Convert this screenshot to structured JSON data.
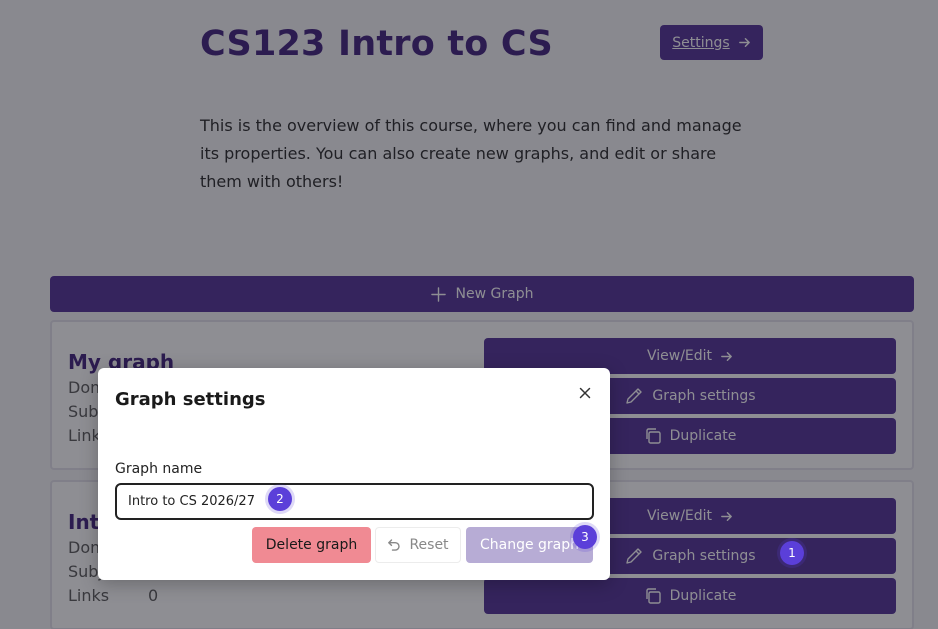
{
  "course": {
    "title": "CS123 Intro to CS",
    "settings_label": "Settings",
    "overview": "This is the overview of this course, where you can find and manage its properties. You can also create new graphs, and edit or share them with others!"
  },
  "new_graph_label": "New Graph",
  "graphs": [
    {
      "name": "My graph",
      "domain_label": "Dom",
      "subject_label": "Subj",
      "links_label": "Links",
      "links_value": ""
    },
    {
      "name": "Int",
      "domain_label": "Dom",
      "subject_label": "Subj",
      "links_label": "Links",
      "links_value": "0"
    }
  ],
  "actions": {
    "view_edit": "View/Edit",
    "graph_settings": "Graph settings",
    "duplicate": "Duplicate"
  },
  "modal": {
    "title": "Graph settings",
    "field_label": "Graph name",
    "field_value": "Intro to CS 2026/27",
    "delete_label": "Delete graph",
    "reset_label": "Reset",
    "change_label": "Change graph"
  },
  "badges": [
    "1",
    "2",
    "3"
  ],
  "colors": {
    "primary": "#4c2a93",
    "title": "#3b1a78",
    "danger": "#f08a93",
    "disabled": "#b7acd5",
    "badge": "#5b3fd9"
  }
}
